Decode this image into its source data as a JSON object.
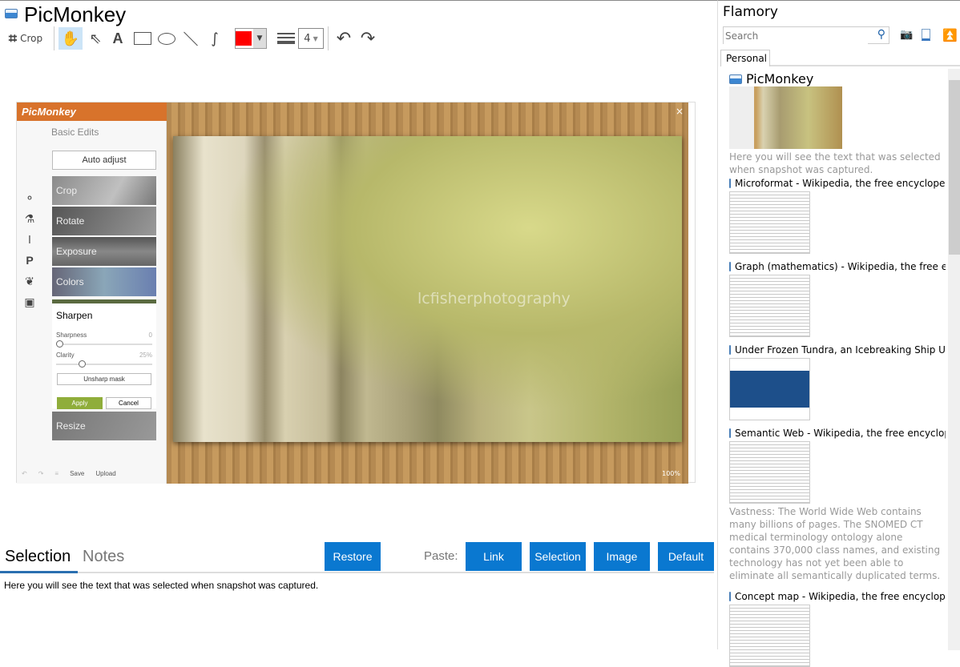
{
  "window": {
    "title": "PicMonkey"
  },
  "toolbar": {
    "crop_label": "Crop",
    "line_width": "4",
    "color": "#ff0000"
  },
  "picmonkey": {
    "logo": "PicMonkey",
    "section": "Basic Edits",
    "auto_adjust": "Auto adjust",
    "tools": [
      "Crop",
      "Rotate",
      "Exposure",
      "Colors"
    ],
    "sharpen": {
      "title": "Sharpen",
      "sharpness_label": "Sharpness",
      "sharpness_value": "0",
      "clarity_label": "Clarity",
      "clarity_value": "25%",
      "sharpness_fraction": 0,
      "clarity_fraction": 0.25,
      "unsharp": "Unsharp mask",
      "apply": "Apply",
      "cancel": "Cancel"
    },
    "resize": "Resize",
    "footer": {
      "save": "Save",
      "upload": "Upload"
    },
    "zoom": "100%",
    "watermark": "lcfisherphotography"
  },
  "bottom": {
    "tabs": [
      "Selection",
      "Notes"
    ],
    "restore": "Restore",
    "paste_label": "Paste:",
    "paste_buttons": [
      "Link",
      "Selection",
      "Image",
      "Default"
    ],
    "content": "Here you will see the text that was selected when snapshot was captured."
  },
  "flamory": {
    "title": "Flamory",
    "search_placeholder": "Search",
    "tab": "Personal",
    "items": [
      {
        "title": "PicMonkey",
        "desc": "Here you will see the text that was selected when snapshot was captured."
      },
      {
        "title": "Microformat - Wikipedia, the free encyclopedia",
        "desc": ""
      },
      {
        "title": "Graph (mathematics) - Wikipedia, the free encyclopedia",
        "desc": ""
      },
      {
        "title": "Under Frozen Tundra, an Icebreaking Ship Uncovers",
        "desc": ""
      },
      {
        "title": "Semantic Web - Wikipedia, the free encyclopedia",
        "desc": "Vastness: The World Wide Web contains many billions of pages. The SNOMED CT medical terminology ontology alone contains 370,000 class names, and existing technology has not yet been able to eliminate all semantically duplicated terms. Any automated reasoning system will have to deal with truly huge inputs."
      },
      {
        "title": "Concept map - Wikipedia, the free encyclopedia",
        "desc": ""
      }
    ]
  }
}
